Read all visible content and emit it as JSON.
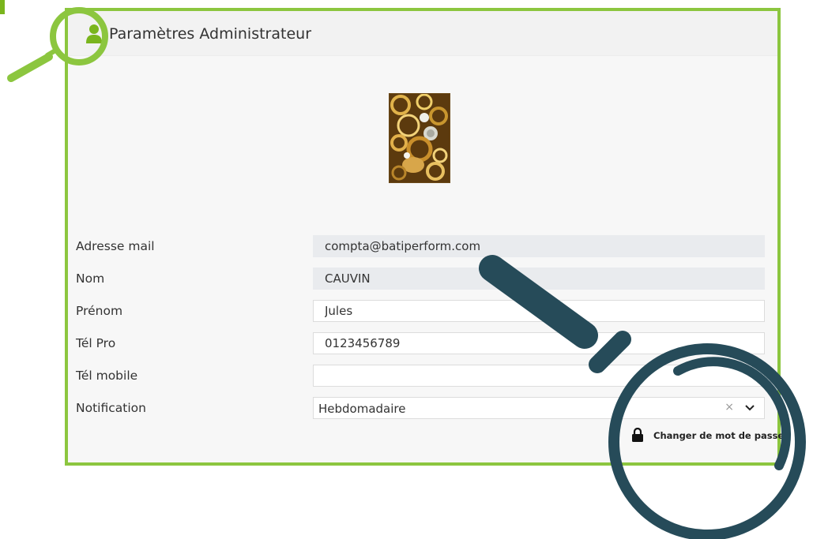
{
  "header": {
    "title": "Paramètres Administrateur",
    "icon": "user-icon"
  },
  "avatar": {
    "alt": "photo de profil"
  },
  "form": {
    "email": {
      "label": "Adresse mail",
      "value": "compta@batiperform.com"
    },
    "nom": {
      "label": "Nom",
      "value": "CAUVIN"
    },
    "prenom": {
      "label": "Prénom",
      "value": "Jules"
    },
    "tel_pro": {
      "label": "Tél Pro",
      "value": "0123456789"
    },
    "tel_mobile": {
      "label": "Tél mobile",
      "value": ""
    },
    "notification": {
      "label": "Notification",
      "value": "Hebdomadaire",
      "clear": "×"
    }
  },
  "actions": {
    "change_password": "Changer de mot de passe"
  },
  "colors": {
    "accent_green": "#8cc63f",
    "magnifier_dark": "#264b59"
  }
}
